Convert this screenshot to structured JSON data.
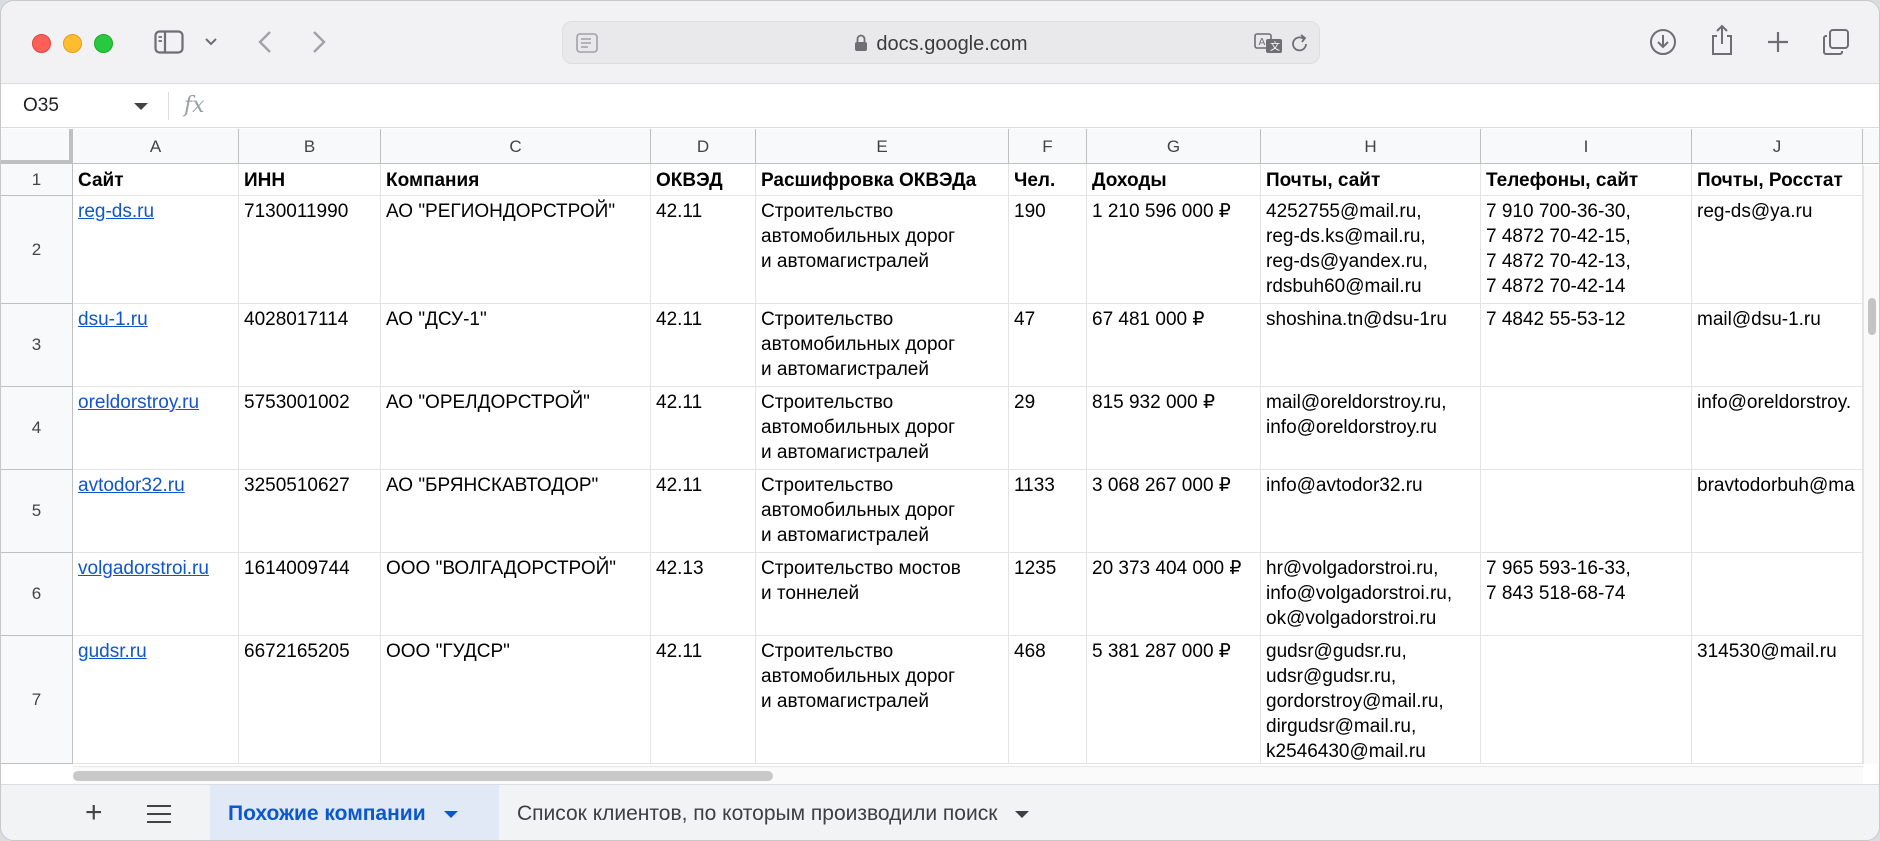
{
  "browser": {
    "url": "docs.google.com"
  },
  "formula_bar": {
    "cell_ref": "O35",
    "fx_label": "fx"
  },
  "columns": [
    "A",
    "B",
    "C",
    "D",
    "E",
    "F",
    "G",
    "H",
    "I",
    "J"
  ],
  "rows": [
    {
      "num": "1",
      "cells": [
        "Сайт",
        "ИНН",
        "Компания",
        "ОКВЭД",
        "Расшифровка ОКВЭДа",
        "Чел.",
        "Доходы",
        "Почты, сайт",
        "Телефоны, сайт",
        "Почты, Росстат"
      ]
    },
    {
      "num": "2",
      "cells": [
        "reg-ds.ru",
        "7130011990",
        "АО \"РЕГИОНДОРСТРОЙ\"",
        "42.11",
        "Строительство\nавтомобильных дорог\nи автомагистралей",
        "190",
        "1 210 596 000 ₽",
        "4252755@mail.ru,\nreg-ds.ks@mail.ru,\nreg-ds@yandex.ru,\nrdsbuh60@mail.ru",
        "7 910 700-36-30,\n7 4872 70-42-15,\n7 4872 70-42-13,\n7 4872 70-42-14",
        "reg-ds@ya.ru"
      ]
    },
    {
      "num": "3",
      "cells": [
        "dsu-1.ru",
        "4028017114",
        "АО \"ДСУ-1\"",
        "42.11",
        "Строительство\nавтомобильных дорог\nи автомагистралей",
        "47",
        "67 481 000 ₽",
        "shoshina.tn@dsu-1ru",
        "7 4842 55-53-12",
        "mail@dsu-1.ru"
      ]
    },
    {
      "num": "4",
      "cells": [
        "oreldorstroy.ru",
        "5753001002",
        "АО \"ОРЕЛДОРСТРОЙ\"",
        "42.11",
        "Строительство\nавтомобильных дорог\nи автомагистралей",
        "29",
        "815 932 000 ₽",
        "mail@oreldorstroy.ru,\ninfo@oreldorstroy.ru",
        "",
        "info@oreldorstroy."
      ]
    },
    {
      "num": "5",
      "cells": [
        "avtodor32.ru",
        "3250510627",
        "АО \"БРЯНСКАВТОДОР\"",
        "42.11",
        "Строительство\nавтомобильных дорог\nи автомагистралей",
        "1133",
        "3 068 267 000 ₽",
        "info@avtodor32.ru",
        "",
        "bravtodorbuh@ma"
      ]
    },
    {
      "num": "6",
      "cells": [
        "volgadorstroi.ru",
        "1614009744",
        "ООО \"ВОЛГАДОРСТРОЙ\"",
        "42.13",
        "Строительство мостов\nи тоннелей",
        "1235",
        "20 373 404 000 ₽",
        "hr@volgadorstroi.ru,\ninfo@volgadorstroi.ru,\nok@volgadorstroi.ru",
        "7 965 593-16-33,\n7 843 518-68-74",
        ""
      ]
    },
    {
      "num": "7",
      "cells": [
        "gudsr.ru",
        "6672165205",
        "ООО \"ГУДСР\"",
        "42.11",
        "Строительство\nавтомобильных дорог\nи автомагистралей",
        "468",
        "5 381 287 000 ₽",
        "gudsr@gudsr.ru,\nudsr@gudsr.ru,\ngordorstroy@mail.ru,\ndirgudsr@mail.ru,\nk2546430@mail.ru",
        "",
        "314530@mail.ru"
      ]
    }
  ],
  "sheet_tabs": {
    "active": "Похожие компании",
    "inactive": "Список клиентов, по которым производили поиск"
  },
  "colors": {
    "link": "#1155cc",
    "active_tab_bg": "#e1e9f7",
    "active_tab_text": "#0b57d0"
  }
}
